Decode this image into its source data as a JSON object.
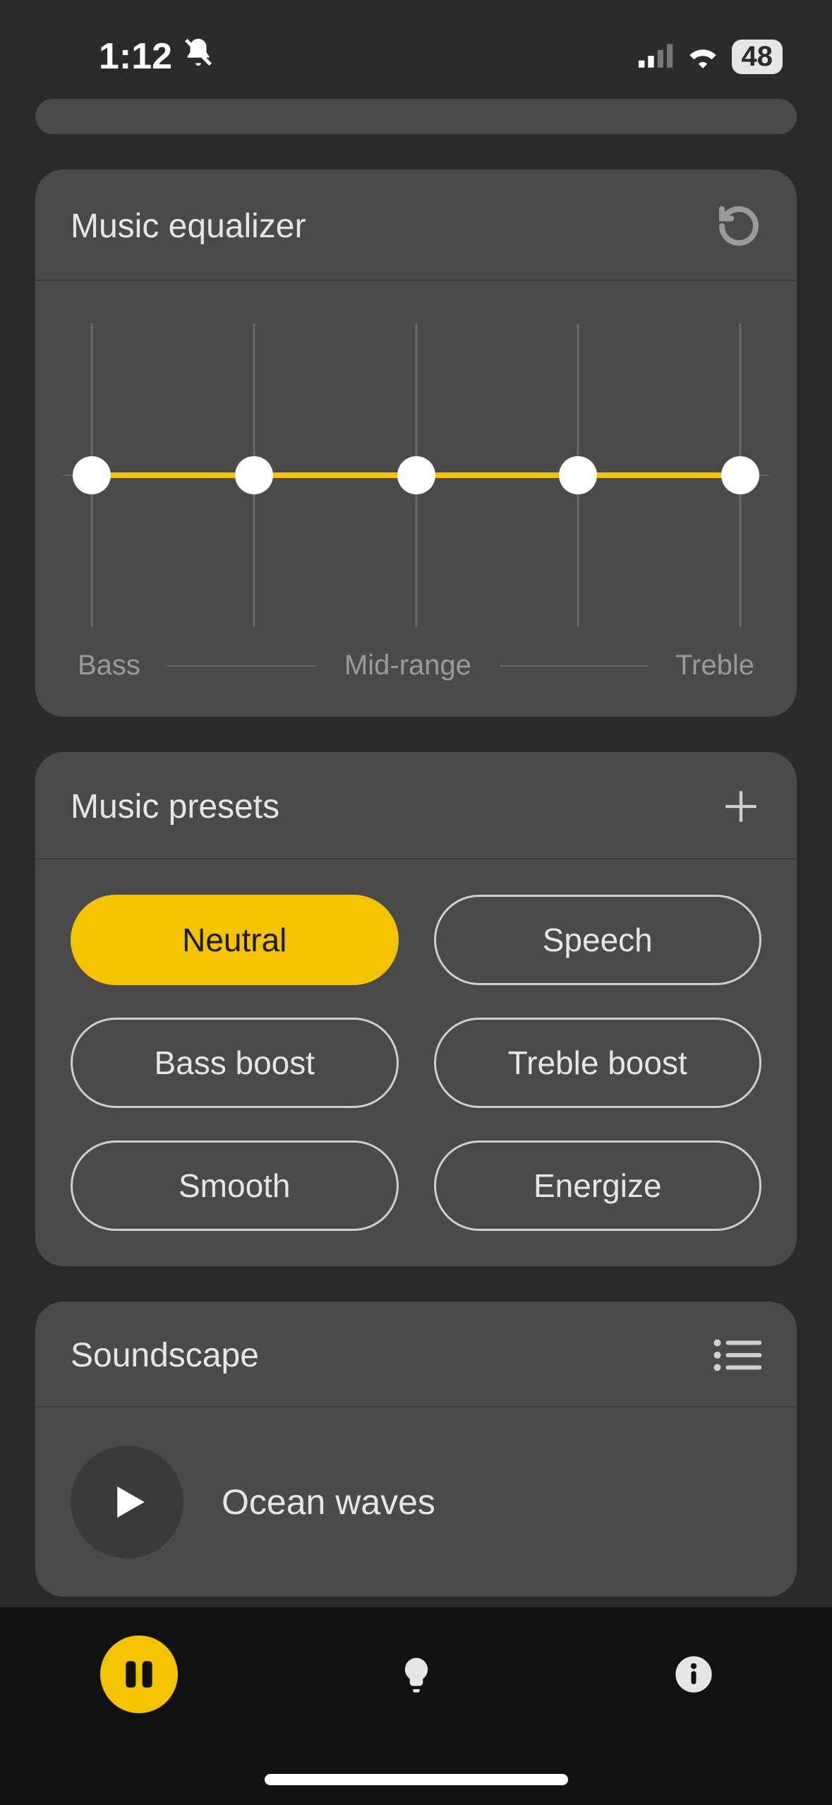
{
  "status": {
    "time": "1:12",
    "battery": "48"
  },
  "equalizer": {
    "title": "Music equalizer",
    "labels": {
      "bass": "Bass",
      "mid": "Mid-range",
      "treble": "Treble"
    },
    "bands": [
      {
        "pos": 0,
        "value": 0
      },
      {
        "pos": 25,
        "value": 0
      },
      {
        "pos": 50,
        "value": 0
      },
      {
        "pos": 75,
        "value": 0
      },
      {
        "pos": 100,
        "value": 0
      }
    ]
  },
  "presets": {
    "title": "Music presets",
    "items": [
      {
        "label": "Neutral",
        "active": true
      },
      {
        "label": "Speech",
        "active": false
      },
      {
        "label": "Bass boost",
        "active": false
      },
      {
        "label": "Treble boost",
        "active": false
      },
      {
        "label": "Smooth",
        "active": false
      },
      {
        "label": "Energize",
        "active": false
      }
    ]
  },
  "soundscape": {
    "title": "Soundscape",
    "track": "Ocean waves"
  },
  "colors": {
    "accent": "#f3c200",
    "card": "#4a4a4c",
    "bg": "#2a2a2a"
  }
}
